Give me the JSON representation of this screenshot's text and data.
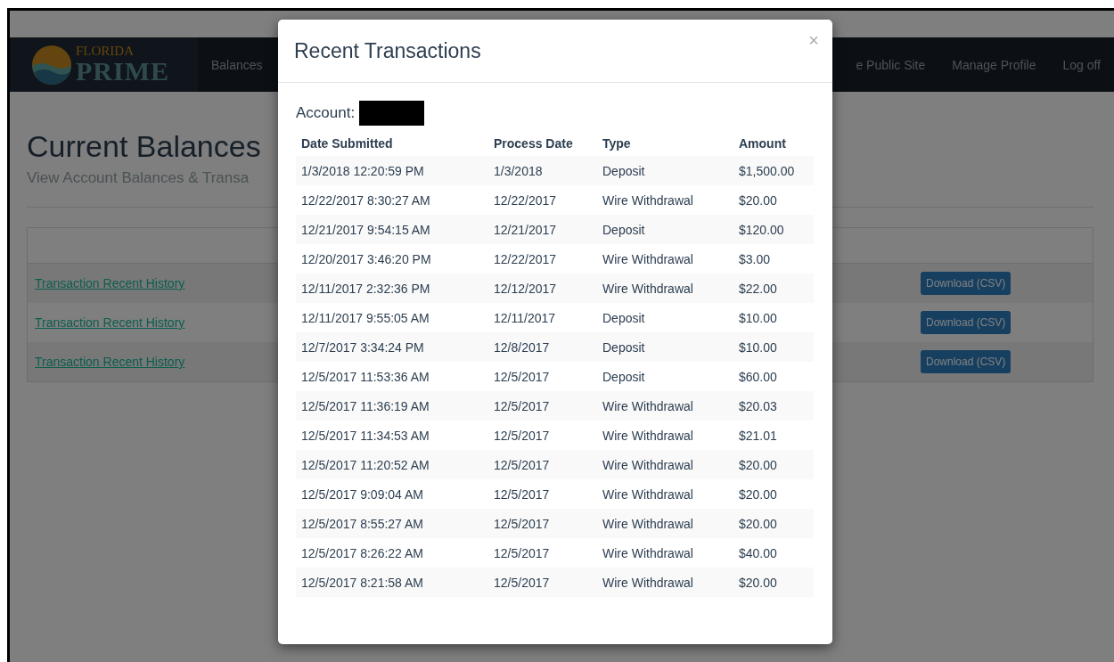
{
  "brand": {
    "top": "FLORIDA",
    "main": "PRIME"
  },
  "nav": {
    "left": [
      {
        "label": "Balances"
      }
    ],
    "right": [
      {
        "label": "e Public Site"
      },
      {
        "label": "Manage Profile"
      },
      {
        "label": "Log off"
      }
    ]
  },
  "page": {
    "title": "Current Balances",
    "subtitle": "View Account Balances & Transa",
    "rows": [
      {
        "link": "Transaction Recent History",
        "button": "Download (CSV)"
      },
      {
        "link": "Transaction Recent History",
        "button": "Download (CSV)"
      },
      {
        "link": "Transaction Recent History",
        "button": "Download (CSV)"
      }
    ]
  },
  "modal": {
    "title": "Recent Transactions",
    "close": "×",
    "account_label": "Account:",
    "columns": [
      "Date Submitted",
      "Process Date",
      "Type",
      "Amount"
    ],
    "rows": [
      [
        "1/3/2018 12:20:59 PM",
        "1/3/2018",
        "Deposit",
        "$1,500.00"
      ],
      [
        "12/22/2017 8:30:27 AM",
        "12/22/2017",
        "Wire Withdrawal",
        "$20.00"
      ],
      [
        "12/21/2017 9:54:15 AM",
        "12/21/2017",
        "Deposit",
        "$120.00"
      ],
      [
        "12/20/2017 3:46:20 PM",
        "12/22/2017",
        "Wire Withdrawal",
        "$3.00"
      ],
      [
        "12/11/2017 2:32:36 PM",
        "12/12/2017",
        "Wire Withdrawal",
        "$22.00"
      ],
      [
        "12/11/2017 9:55:05 AM",
        "12/11/2017",
        "Deposit",
        "$10.00"
      ],
      [
        "12/7/2017 3:34:24 PM",
        "12/8/2017",
        "Deposit",
        "$10.00"
      ],
      [
        "12/5/2017 11:53:36 AM",
        "12/5/2017",
        "Deposit",
        "$60.00"
      ],
      [
        "12/5/2017 11:36:19 AM",
        "12/5/2017",
        "Wire Withdrawal",
        "$20.03"
      ],
      [
        "12/5/2017 11:34:53 AM",
        "12/5/2017",
        "Wire Withdrawal",
        "$21.01"
      ],
      [
        "12/5/2017 11:20:52 AM",
        "12/5/2017",
        "Wire Withdrawal",
        "$20.00"
      ],
      [
        "12/5/2017 9:09:04 AM",
        "12/5/2017",
        "Wire Withdrawal",
        "$20.00"
      ],
      [
        "12/5/2017 8:55:27 AM",
        "12/5/2017",
        "Wire Withdrawal",
        "$20.00"
      ],
      [
        "12/5/2017 8:26:22 AM",
        "12/5/2017",
        "Wire Withdrawal",
        "$40.00"
      ],
      [
        "12/5/2017 8:21:58 AM",
        "12/5/2017",
        "Wire Withdrawal",
        "$20.00"
      ]
    ]
  }
}
